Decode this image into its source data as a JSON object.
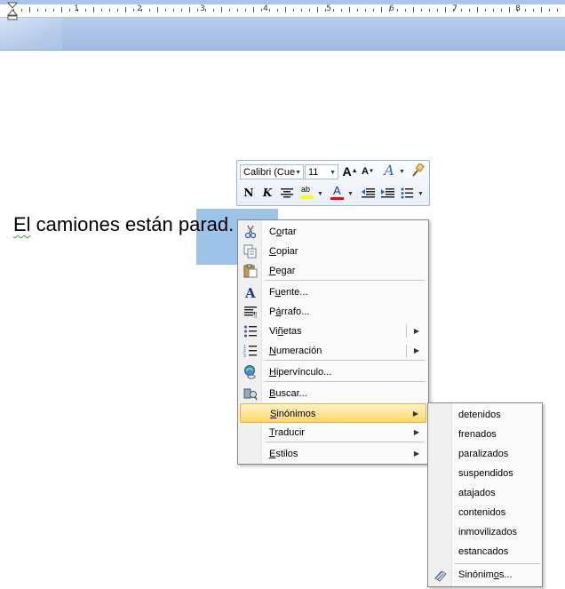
{
  "ruler": {
    "numbers": [
      "1",
      "2",
      "3",
      "4",
      "5",
      "6",
      "7",
      "8"
    ]
  },
  "document": {
    "text_before": "El",
    "text_middle": " camiones están ",
    "text_selected": "parad",
    "text_after": "."
  },
  "mini_toolbar": {
    "font_name": "Calibri (Cue",
    "font_size": "11",
    "grow_font_label": "A",
    "shrink_font_label": "A",
    "styles_label": "A",
    "bold_label": "N",
    "italic_label": "K",
    "font_color_label": "A",
    "highlight_label": "ab",
    "icons": [
      "grow-font-icon",
      "shrink-font-icon",
      "styles-icon",
      "format-painter-icon",
      "bold-icon",
      "italic-icon",
      "center-icon",
      "highlight-icon",
      "font-color-icon",
      "decrease-indent-icon",
      "increase-indent-icon",
      "bullets-icon"
    ]
  },
  "context_menu": {
    "items": [
      {
        "id": "cut",
        "pre": "C",
        "ul": "o",
        "post": "rtar",
        "icon": "scissors-icon"
      },
      {
        "id": "copy",
        "pre": "",
        "ul": "C",
        "post": "opiar",
        "icon": "copy-icon"
      },
      {
        "id": "paste",
        "pre": "",
        "ul": "P",
        "post": "egar",
        "icon": "paste-icon"
      },
      {
        "id": "font",
        "pre": "F",
        "ul": "u",
        "post": "ente...",
        "icon": "font-icon"
      },
      {
        "id": "paragraph",
        "pre": "P",
        "ul": "á",
        "post": "rrafo...",
        "icon": "paragraph-icon"
      },
      {
        "id": "bullets",
        "pre": "Vi",
        "ul": "ñ",
        "post": "etas",
        "icon": "bullets-icon"
      },
      {
        "id": "numbering",
        "pre": "",
        "ul": "N",
        "post": "umeración",
        "icon": "numbering-icon"
      },
      {
        "id": "hyperlink",
        "pre": "",
        "ul": "H",
        "post": "ipervínculo...",
        "icon": "hyperlink-icon"
      },
      {
        "id": "search",
        "pre": "",
        "ul": "B",
        "post": "uscar...",
        "icon": "search-icon"
      },
      {
        "id": "synonyms",
        "pre": "",
        "ul": "S",
        "post": "inónimos",
        "icon": ""
      },
      {
        "id": "translate",
        "pre": "",
        "ul": "T",
        "post": "raducir",
        "icon": ""
      },
      {
        "id": "styles",
        "pre": "",
        "ul": "E",
        "post": "stilos",
        "icon": ""
      }
    ]
  },
  "synonyms_menu": {
    "items": [
      "detenidos",
      "frenados",
      "paralizados",
      "suspendidos",
      "atajados",
      "contenidos",
      "inmovilizados",
      "estancados"
    ],
    "footer_pre": "Sinónim",
    "footer_ul": "o",
    "footer_post": "s...",
    "footer_icon": "thesaurus-icon"
  },
  "colors": {
    "selection": "#9ec3e8",
    "highlight_menu": "#ffd66b",
    "font_color_bar": "#ff0000",
    "highlight_bar": "#ffff00"
  }
}
